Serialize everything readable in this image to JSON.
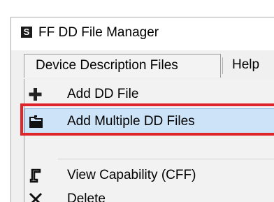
{
  "window": {
    "title": "FF DD File Manager",
    "app_icon_glyph": "S",
    "app_icon": "app-logo-icon"
  },
  "menubar": {
    "items": [
      {
        "label": "Device Description Files",
        "active": true
      },
      {
        "label": "Help",
        "active": false
      }
    ]
  },
  "dropdown": {
    "items": [
      {
        "label": "Add DD File",
        "icon": "plus-icon",
        "highlighted": false
      },
      {
        "label": "Add Multiple DD Files",
        "icon": "folder-icon",
        "highlighted": true
      },
      {
        "label": "View Capability (CFF)",
        "icon": "capability-icon",
        "highlighted": false
      },
      {
        "label": "Delete",
        "icon": "delete-x-icon",
        "highlighted": false
      }
    ]
  },
  "colors": {
    "highlight_fill": "#cde3f7",
    "annotation_box": "#e0242c"
  }
}
